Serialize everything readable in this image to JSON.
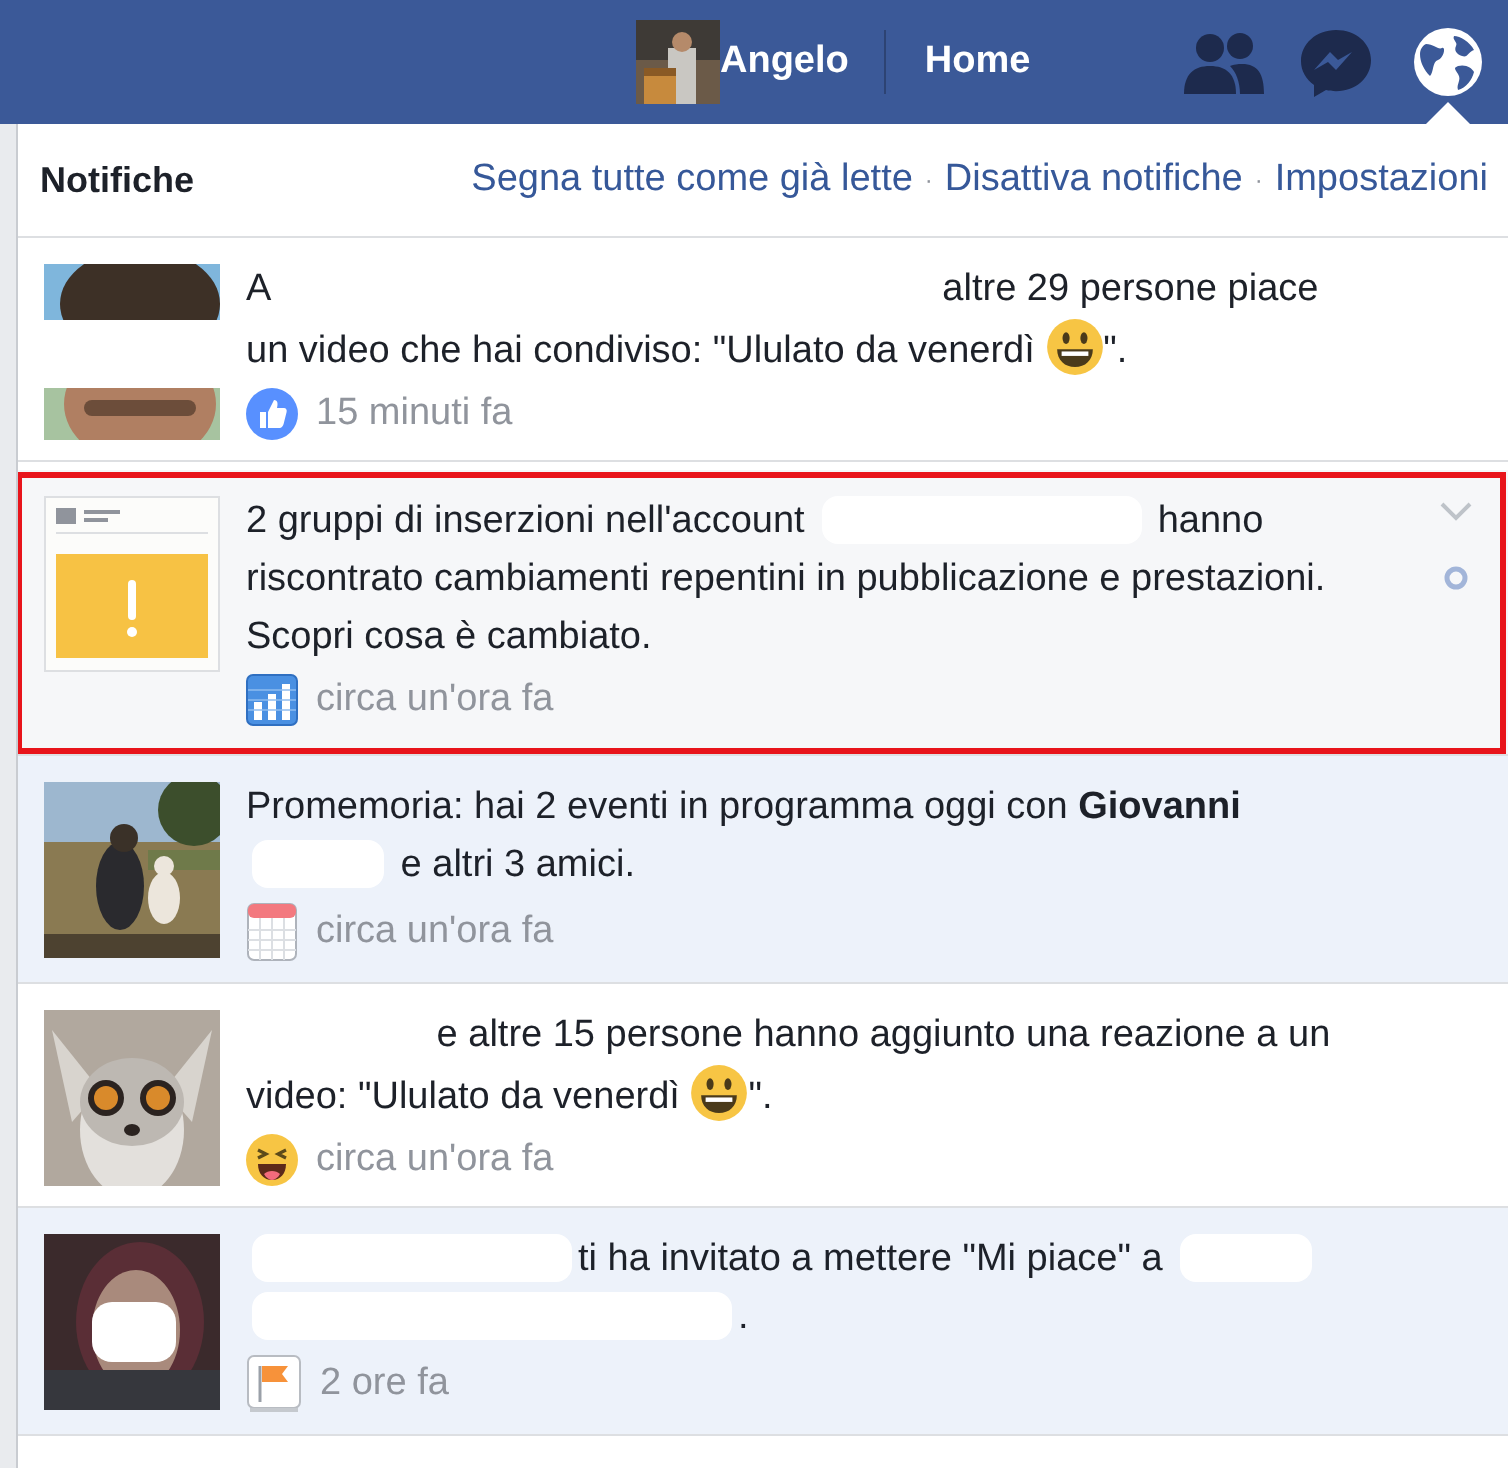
{
  "top_bar": {
    "profile_name": "Angelo",
    "home_link": "Home",
    "icons": [
      {
        "kind": "friends",
        "selected": false
      },
      {
        "kind": "messages",
        "selected": false
      },
      {
        "kind": "notifications",
        "selected": true
      }
    ]
  },
  "notifications_panel": {
    "title": "Notifiche",
    "actions": [
      {
        "kind": "link",
        "text": "Segna tutte come già lette"
      },
      {
        "kind": "separator",
        "text": "·"
      },
      {
        "kind": "link",
        "text": "Disattiva notifiche"
      },
      {
        "kind": "separator",
        "text": "·"
      },
      {
        "kind": "link",
        "text": "Impostazioni"
      }
    ],
    "items": [
      {
        "read": true,
        "highlighted": false,
        "thumbnail": {
          "kind": "picture"
        },
        "badge": {
          "kind": "like"
        },
        "time": "15 minuti fa",
        "text": [
          {
            "kind": "text",
            "text": "A "
          },
          {
            "kind": "redacted_xxl"
          },
          {
            "kind": "text",
            "text": " altre 29 persone piace un video che hai condiviso: \"Ululato da venerdì "
          },
          {
            "kind": "emoji"
          },
          {
            "kind": "text",
            "text": "\"."
          }
        ]
      },
      {
        "read": true,
        "highlighted": true,
        "thumbnail": {
          "kind": "ad_warning"
        },
        "badge": {
          "kind": "chart"
        },
        "time": "circa un'ora fa",
        "text": [
          {
            "kind": "text",
            "text": "2 gruppi di inserzioni nell'account "
          },
          {
            "kind": "redacted_l"
          },
          {
            "kind": "text",
            "text": " hanno riscontrato cambiamenti repentini in pubblicazione e prestazioni. Scopri cosa è cambiato."
          }
        ]
      },
      {
        "read": false,
        "highlighted": false,
        "thumbnail": {
          "kind": "picture"
        },
        "badge": {
          "kind": "calendar"
        },
        "time": "circa un'ora fa",
        "text": [
          {
            "kind": "text",
            "text": "Promemoria: hai 2 eventi in programma oggi con "
          },
          {
            "kind": "bold",
            "text": "Giovanni"
          },
          {
            "kind": "redacted_s"
          },
          {
            "kind": "text",
            "text": " e altri 3 amici."
          }
        ]
      },
      {
        "read": true,
        "highlighted": false,
        "thumbnail": {
          "kind": "picture"
        },
        "badge": {
          "kind": "laugh"
        },
        "time": "circa un'ora fa",
        "text": [
          {
            "kind": "redacted_m"
          },
          {
            "kind": "text",
            "text": " e altre 15 persone hanno aggiunto una reazione a un video: \"Ululato da venerdì "
          },
          {
            "kind": "emoji"
          },
          {
            "kind": "text",
            "text": "\"."
          }
        ]
      },
      {
        "read": false,
        "highlighted": false,
        "thumbnail": {
          "kind": "picture"
        },
        "badge": {
          "kind": "flag"
        },
        "time": "2 ore fa",
        "text": [
          {
            "kind": "redacted_l"
          },
          {
            "kind": "text",
            "text": "ti ha invitato a mettere \"Mi piace\" a "
          },
          {
            "kind": "redacted_s"
          },
          {
            "kind": "redacted_xl"
          },
          {
            "kind": "text",
            "text": "."
          }
        ]
      }
    ]
  }
}
